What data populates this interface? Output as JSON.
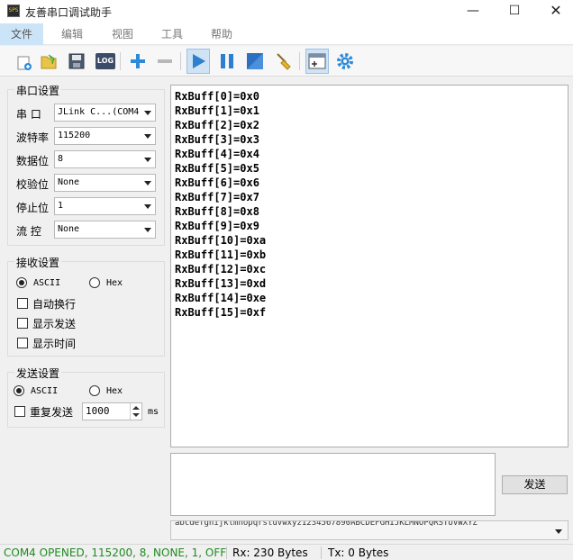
{
  "window": {
    "title": "友善串口调试助手",
    "app_icon_text": "SPS"
  },
  "menu": [
    "文件",
    "编辑",
    "视图",
    "工具",
    "帮助"
  ],
  "toolbar": {
    "log_label": "LOG",
    "buttons": [
      "new-doc-icon",
      "open-folder-icon",
      "save-icon",
      "log-icon",
      "add-icon",
      "remove-icon",
      "play-icon",
      "pause-icon",
      "stop-icon",
      "clear-broom-icon",
      "layout-icon",
      "settings-gear-icon"
    ]
  },
  "serial_settings": {
    "title": "串口设置",
    "port_label": "串  口",
    "port_value": "JLink C...(COM4",
    "baud_label": "波特率",
    "baud_value": "115200",
    "databits_label": "数据位",
    "databits_value": "8",
    "parity_label": "校验位",
    "parity_value": "None",
    "stopbits_label": "停止位",
    "stopbits_value": "1",
    "flow_label": "流  控",
    "flow_value": "None"
  },
  "receive_settings": {
    "title": "接收设置",
    "ascii_label": "ASCII",
    "hex_label": "Hex",
    "mode": "ASCII",
    "auto_wrap_label": "自动换行",
    "show_send_label": "显示发送",
    "show_time_label": "显示时间"
  },
  "send_settings": {
    "title": "发送设置",
    "ascii_label": "ASCII",
    "hex_label": "Hex",
    "mode": "ASCII",
    "repeat_label": "重复发送",
    "interval_value": "1000",
    "interval_unit": "ms"
  },
  "receive_lines": [
    "RxBuff[0]=0x0",
    "RxBuff[1]=0x1",
    "RxBuff[2]=0x2",
    "RxBuff[3]=0x3",
    "RxBuff[4]=0x4",
    "RxBuff[5]=0x5",
    "RxBuff[6]=0x6",
    "RxBuff[7]=0x7",
    "RxBuff[8]=0x8",
    "RxBuff[9]=0x9",
    "RxBuff[10]=0xa",
    "RxBuff[11]=0xb",
    "RxBuff[12]=0xc",
    "RxBuff[13]=0xd",
    "RxBuff[14]=0xe",
    "RxBuff[15]=0xf"
  ],
  "send_button_label": "发送",
  "history_text": "abcdefghijklmnopqrstuvwxyz1234567890ABCDEFGHIJKLMNOPQRSTUVWXYZ",
  "status": {
    "connection": "COM4 OPENED, 115200, 8, NONE, 1, OFF",
    "rx": "Rx: 230 Bytes",
    "tx": "Tx: 0 Bytes",
    "connection_color": "#1f8a1f"
  }
}
